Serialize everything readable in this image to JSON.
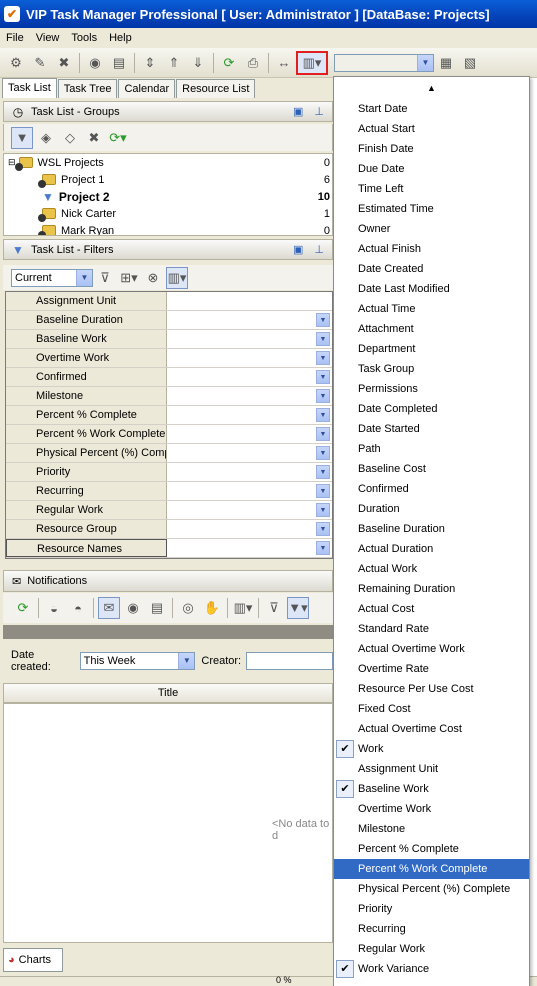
{
  "app": {
    "title": "VIP Task Manager Professional [ User: Administrator ] [DataBase: Projects]"
  },
  "menubar": [
    "File",
    "View",
    "Tools",
    "Help"
  ],
  "tabs": [
    "Task List",
    "Task Tree",
    "Calendar",
    "Resource List"
  ],
  "groups_panel": {
    "title": "Task List - Groups",
    "tree": [
      {
        "label": "WSL Projects",
        "count": "0",
        "bold": false
      },
      {
        "label": "Project 1",
        "count": "6",
        "bold": false
      },
      {
        "label": "Project 2",
        "count": "10",
        "bold": true
      },
      {
        "label": "Nick Carter",
        "count": "1",
        "bold": false
      },
      {
        "label": "Mark Ryan",
        "count": "0",
        "bold": false
      }
    ]
  },
  "filters_panel": {
    "title": "Task List - Filters",
    "current_value": "Current",
    "rows": [
      "Assignment Unit",
      "Baseline Duration",
      "Baseline Work",
      "Overtime Work",
      "Confirmed",
      "Milestone",
      "Percent % Complete",
      "Percent % Work Complete",
      "Physical Percent (%) Comp",
      "Priority",
      "Recurring",
      "Regular Work",
      "Resource Group",
      "Resource Names"
    ]
  },
  "notifications": {
    "title": "Notifications",
    "date_created_label": "Date created:",
    "date_created_value": "This Week",
    "creator_label": "Creator:",
    "column_title": "Title",
    "empty_text": "<No data to d"
  },
  "charts_tab": "Charts",
  "status": {
    "percent": "0 %"
  },
  "column_menu": {
    "items": [
      {
        "label": "Start Date",
        "checked": false
      },
      {
        "label": "Actual Start",
        "checked": false
      },
      {
        "label": "Finish Date",
        "checked": false
      },
      {
        "label": "Due Date",
        "checked": false
      },
      {
        "label": "Time Left",
        "checked": false
      },
      {
        "label": "Estimated Time",
        "checked": false
      },
      {
        "label": "Owner",
        "checked": false
      },
      {
        "label": "Actual Finish",
        "checked": false
      },
      {
        "label": "Date Created",
        "checked": false
      },
      {
        "label": "Date Last Modified",
        "checked": false
      },
      {
        "label": "Actual Time",
        "checked": false
      },
      {
        "label": "Attachment",
        "checked": false
      },
      {
        "label": "Department",
        "checked": false
      },
      {
        "label": "Task Group",
        "checked": false
      },
      {
        "label": "Permissions",
        "checked": false
      },
      {
        "label": "Date Completed",
        "checked": false
      },
      {
        "label": "Date Started",
        "checked": false
      },
      {
        "label": "Path",
        "checked": false
      },
      {
        "label": "Baseline Cost",
        "checked": false
      },
      {
        "label": "Confirmed",
        "checked": false
      },
      {
        "label": "Duration",
        "checked": false
      },
      {
        "label": "Baseline Duration",
        "checked": false
      },
      {
        "label": "Actual Duration",
        "checked": false
      },
      {
        "label": "Actual Work",
        "checked": false
      },
      {
        "label": "Remaining Duration",
        "checked": false
      },
      {
        "label": "Actual Cost",
        "checked": false
      },
      {
        "label": "Standard Rate",
        "checked": false
      },
      {
        "label": "Actual Overtime Work",
        "checked": false
      },
      {
        "label": "Overtime Rate",
        "checked": false
      },
      {
        "label": "Resource Per Use Cost",
        "checked": false
      },
      {
        "label": "Fixed Cost",
        "checked": false
      },
      {
        "label": "Actual Overtime Cost",
        "checked": false
      },
      {
        "label": "Work",
        "checked": true
      },
      {
        "label": "Assignment Unit",
        "checked": false
      },
      {
        "label": "Baseline Work",
        "checked": true
      },
      {
        "label": "Overtime Work",
        "checked": false
      },
      {
        "label": "Milestone",
        "checked": false
      },
      {
        "label": "Percent % Complete",
        "checked": false
      },
      {
        "label": "Percent % Work Complete",
        "checked": false,
        "highlighted": true
      },
      {
        "label": "Physical Percent (%) Complete",
        "checked": false
      },
      {
        "label": "Priority",
        "checked": false
      },
      {
        "label": "Recurring",
        "checked": false
      },
      {
        "label": "Regular Work",
        "checked": false
      },
      {
        "label": "Work Variance",
        "checked": true
      }
    ]
  }
}
